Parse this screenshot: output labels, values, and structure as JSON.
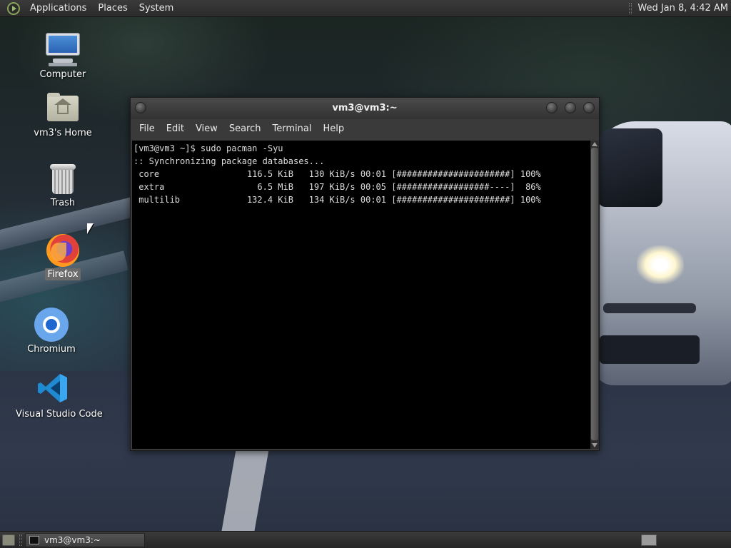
{
  "top_panel": {
    "menus": [
      "Applications",
      "Places",
      "System"
    ],
    "clock": "Wed Jan  8,  4:42 AM"
  },
  "desktop": {
    "icons": [
      {
        "label": "Computer",
        "icon": "computer-icon"
      },
      {
        "label": "vm3's Home",
        "icon": "home-folder-icon"
      },
      {
        "label": "Trash",
        "icon": "trash-icon"
      },
      {
        "label": "Firefox",
        "icon": "firefox-icon",
        "selected": true
      },
      {
        "label": "Chromium",
        "icon": "chromium-icon"
      },
      {
        "label": "Visual Studio Code",
        "icon": "vscode-icon"
      }
    ]
  },
  "terminal": {
    "title": "vm3@vm3:~",
    "menu": [
      "File",
      "Edit",
      "View",
      "Search",
      "Terminal",
      "Help"
    ],
    "lines": [
      "[vm3@vm3 ~]$ sudo pacman -Syu",
      ":: Synchronizing package databases...",
      " core                 116.5 KiB   130 KiB/s 00:01 [######################] 100%",
      " extra                  6.5 MiB   197 KiB/s 00:05 [##################----]  86%",
      " multilib             132.4 KiB   134 KiB/s 00:01 [######################] 100%"
    ]
  },
  "bottom_panel": {
    "task_button": "vm3@vm3:~"
  },
  "colors": {
    "terminal_bg": "#000000",
    "terminal_fg": "#dcdcdc",
    "panel_bg": "#2f2f2f",
    "selection": "#6b6b6b"
  }
}
